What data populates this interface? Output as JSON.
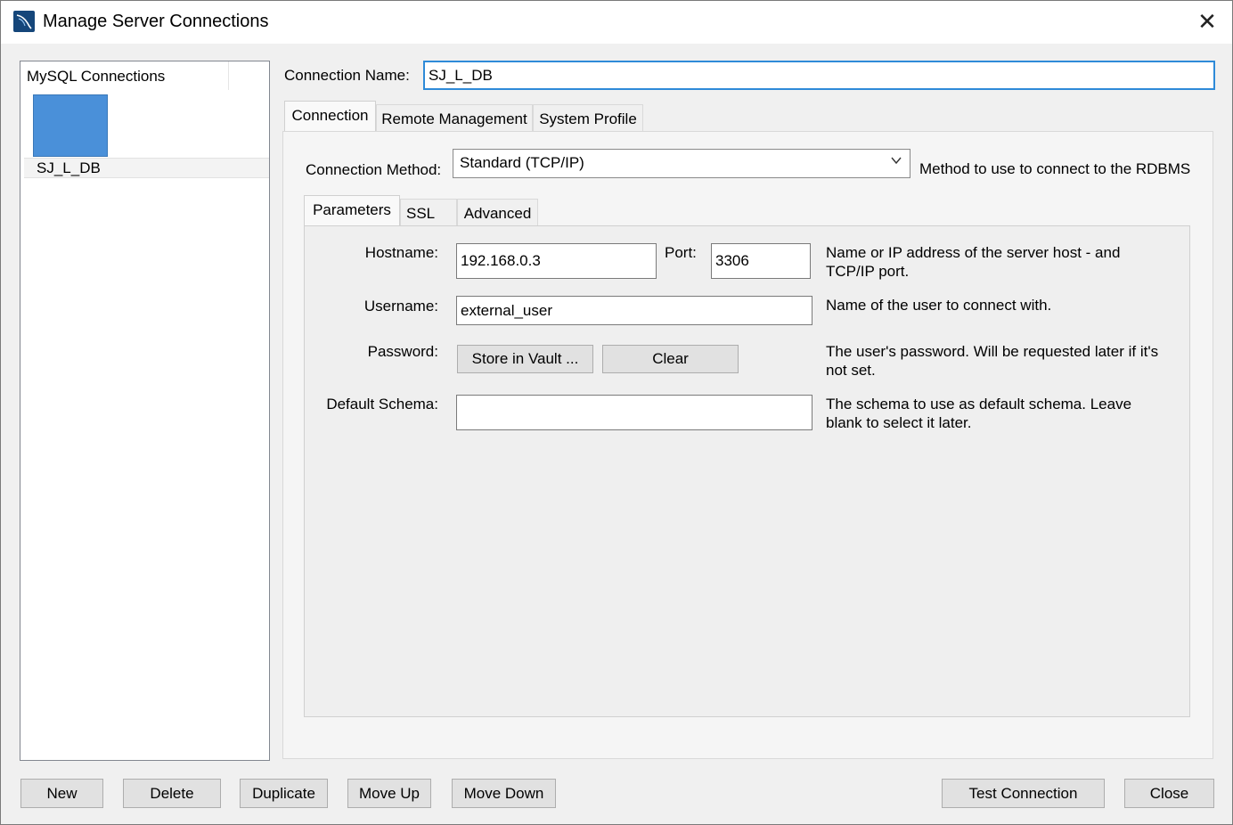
{
  "window": {
    "title": "Manage Server Connections",
    "close_glyph": "✕"
  },
  "list": {
    "header": "MySQL Connections",
    "items": [
      {
        "label": "SJ_L_DB"
      }
    ]
  },
  "form": {
    "connection_name_label": "Connection Name:",
    "connection_name_value": "SJ_L_DB",
    "tabs": [
      "Connection",
      "Remote Management",
      "System Profile"
    ],
    "method_label": "Connection Method:",
    "method_value": "Standard (TCP/IP)",
    "method_help": "Method to use to connect to the RDBMS",
    "subtabs": [
      "Parameters",
      "SSL",
      "Advanced"
    ],
    "hostname_label": "Hostname:",
    "hostname_value": "192.168.0.3",
    "port_label": "Port:",
    "port_value": "3306",
    "hostname_help_1": "Name or IP address of the server host - and",
    "hostname_help_2": "TCP/IP port.",
    "username_label": "Username:",
    "username_value": "external_user",
    "username_help": "Name of the user to connect with.",
    "password_label": "Password:",
    "store_vault_label": "Store in Vault ...",
    "clear_label": "Clear",
    "password_help_1": "The user's password. Will be requested later if it's",
    "password_help_2": "not set.",
    "schema_label": "Default Schema:",
    "schema_value": "",
    "schema_help_1": "The schema to use as default schema. Leave",
    "schema_help_2": "blank to select it later."
  },
  "buttons": {
    "new": "New",
    "delete": "Delete",
    "duplicate": "Duplicate",
    "move_up": "Move Up",
    "move_down": "Move Down",
    "test_connection": "Test Connection",
    "close": "Close"
  },
  "colors": {
    "accent_focus": "#2e8ad8",
    "tile": "#4a90d9",
    "app_icon": "#15467a"
  },
  "icons": {
    "app": "mysql-workbench-icon",
    "close": "close-icon",
    "dropdown": "chevron-down-icon"
  }
}
